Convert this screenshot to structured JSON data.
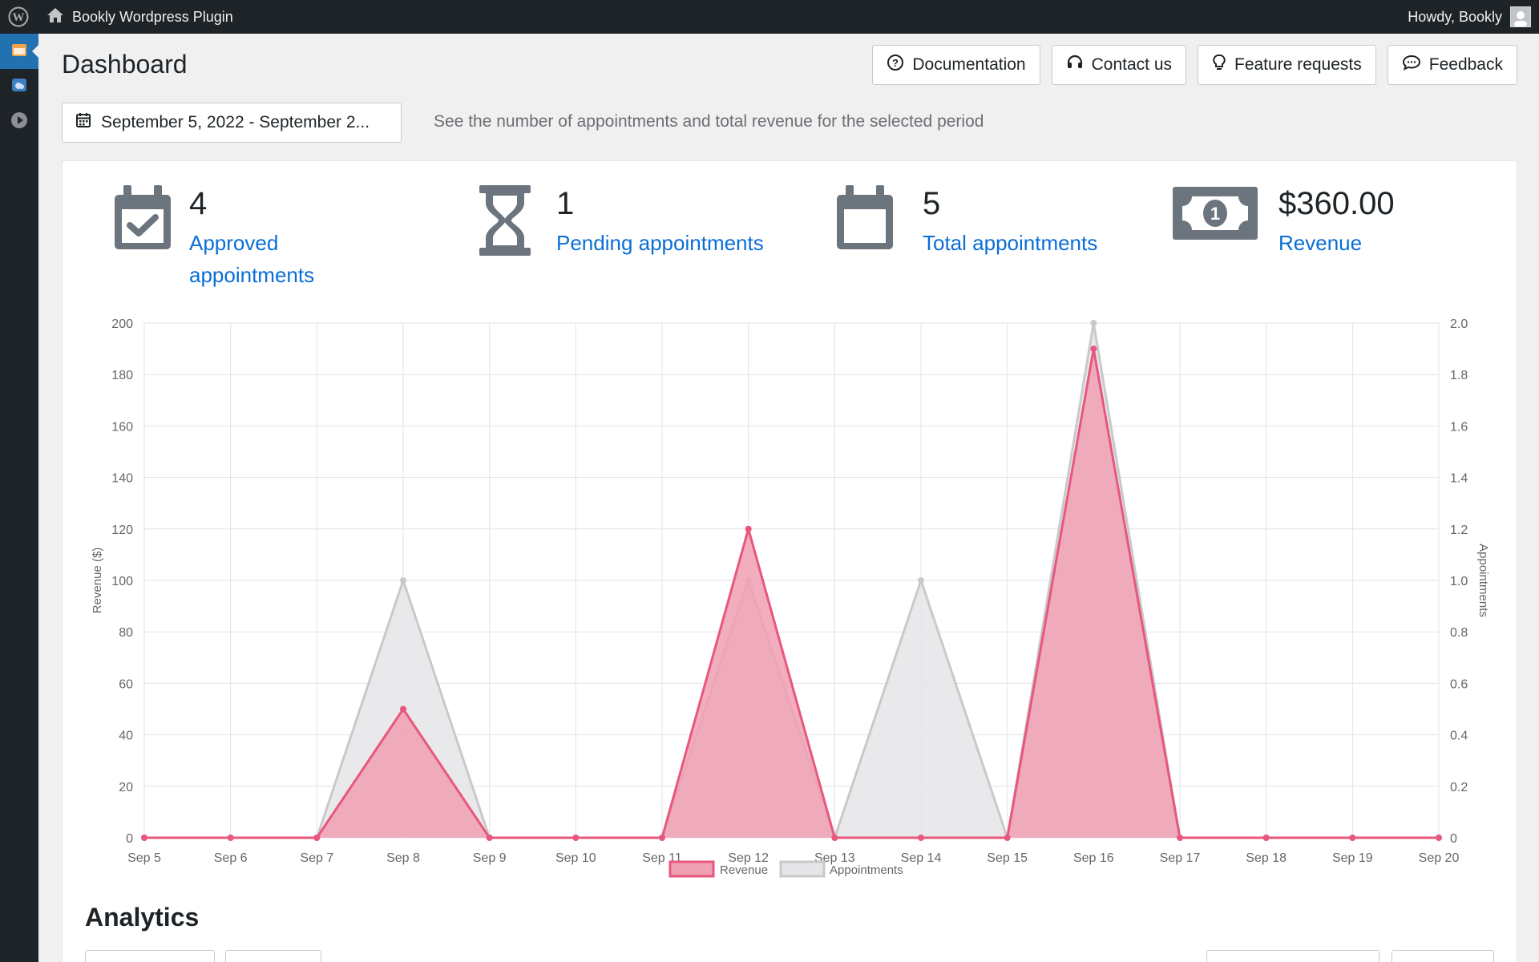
{
  "admin_bar": {
    "site_name": "Bookly Wordpress Plugin",
    "greeting": "Howdy, Bookly"
  },
  "header": {
    "title": "Dashboard",
    "buttons": [
      {
        "label": "Documentation",
        "icon": "question-circle-icon"
      },
      {
        "label": "Contact us",
        "icon": "headset-icon"
      },
      {
        "label": "Feature requests",
        "icon": "lightbulb-icon"
      },
      {
        "label": "Feedback",
        "icon": "comment-icon"
      }
    ]
  },
  "filter": {
    "date_range": "September 5, 2022 - September 2...",
    "hint": "See the number of appointments and total revenue for the selected period"
  },
  "stats": [
    {
      "value": "4",
      "label": "Approved appointments",
      "icon": "calendar-check-icon"
    },
    {
      "value": "1",
      "label": "Pending appointments",
      "icon": "hourglass-icon"
    },
    {
      "value": "5",
      "label": "Total appointments",
      "icon": "calendar-icon"
    },
    {
      "value": "$360.00",
      "label": "Revenue",
      "icon": "money-bill-icon"
    }
  ],
  "colors": {
    "revenue_line": "#e8577e",
    "revenue_fill": "#f0a0b3",
    "appointments_line": "#c9c9cb",
    "appointments_fill": "#e5e5e7",
    "link": "#0a6ed6"
  },
  "chart_data": {
    "type": "area",
    "x": [
      "Sep 5",
      "Sep 6",
      "Sep 7",
      "Sep 8",
      "Sep 9",
      "Sep 10",
      "Sep 11",
      "Sep 12",
      "Sep 13",
      "Sep 14",
      "Sep 15",
      "Sep 16",
      "Sep 17",
      "Sep 18",
      "Sep 19",
      "Sep 20"
    ],
    "series": [
      {
        "name": "Revenue",
        "axis": "left",
        "values": [
          0,
          0,
          0,
          50,
          0,
          0,
          0,
          120,
          0,
          0,
          0,
          190,
          0,
          0,
          0,
          0
        ]
      },
      {
        "name": "Appointments",
        "axis": "right",
        "values": [
          0,
          0,
          0,
          1,
          0,
          0,
          0,
          1,
          0,
          1,
          0,
          2,
          0,
          0,
          0,
          0
        ]
      }
    ],
    "ylabel": "Revenue ($)",
    "y2label": "Appointments",
    "ylim": [
      0,
      200
    ],
    "y2lim": [
      0,
      2
    ],
    "yticks": [
      "0",
      "20",
      "40",
      "60",
      "80",
      "100",
      "120",
      "140",
      "160",
      "180",
      "200"
    ],
    "y2ticks": [
      "0",
      "0.2",
      "0.4",
      "0.6",
      "0.8",
      "1.0",
      "1.2",
      "1.4",
      "1.6",
      "1.8",
      "2.0"
    ],
    "grid": true,
    "legend_position": "bottom"
  },
  "analytics": {
    "title": "Analytics"
  }
}
